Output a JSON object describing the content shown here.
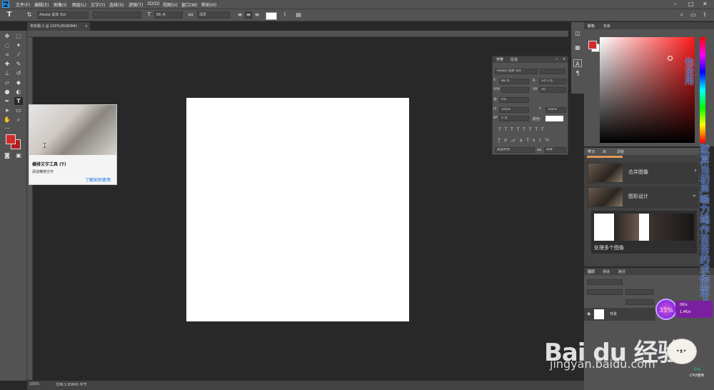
{
  "app": {
    "menus": [
      "文件(F)",
      "编辑(E)",
      "图像(I)",
      "图层(L)",
      "文字(Y)",
      "选择(S)",
      "滤镜(T)",
      "3D(D)",
      "视图(V)",
      "窗口(W)",
      "帮助(H)"
    ]
  },
  "options_bar": {
    "font_family": "Adobe 黑体 Std",
    "font_style": "-",
    "font_size": "88 点",
    "antialias": "浑厚"
  },
  "document": {
    "tab_title": "未标题-1 @ 100%(RGB/8#)",
    "zoom": "100%",
    "doc_info": "文档:1.83M/0 字节"
  },
  "tooltip": {
    "title": "横排文字工具 (T)",
    "description": "添加横排文字",
    "link": "了解如何使用"
  },
  "character_panel": {
    "tabs": [
      "字符",
      "段落"
    ],
    "font_family": "Adobe 黑体 Std",
    "font_style": "-",
    "font_size": "88 点",
    "leading": "14.5 点",
    "kerning": "",
    "tracking": "20",
    "scale_pct": "0%",
    "vertical_scale": "100%",
    "horizontal_scale": "100%",
    "baseline": "0 点",
    "color_label": "颜色:",
    "language": "美国英语",
    "antialias": "浑厚"
  },
  "color_panel": {
    "tabs": [
      "颜色",
      "色板"
    ],
    "foreground_color": "#d42a2a",
    "background_color": "#ffffff"
  },
  "learn_panel": {
    "tabs": [
      "学习",
      "库",
      "调整"
    ],
    "items": [
      "合并图像",
      "图形设计",
      "处理多个图像"
    ]
  },
  "layers_panel": {
    "tabs": [
      "图层",
      "通道",
      "路径"
    ],
    "layer_name": "背景"
  },
  "overlays": {
    "danmaku_1": "也没用",
    "danmaku_2": "就算当初声嘶力竭作苦苦的求你留下别",
    "speed_percent": "35%",
    "speed_up": "0K/s",
    "speed_down": "1.4K/s",
    "watermark": "Bai du 经验",
    "watermark_url": "jingyan.baidu.com",
    "cpu_percent": "0%",
    "cpu_label": "CPU使用"
  },
  "colors": {
    "ui_dark": "#282828",
    "ui_panel": "#535353",
    "accent_blue": "#1473e6",
    "foreground_red": "#d42a2a"
  }
}
